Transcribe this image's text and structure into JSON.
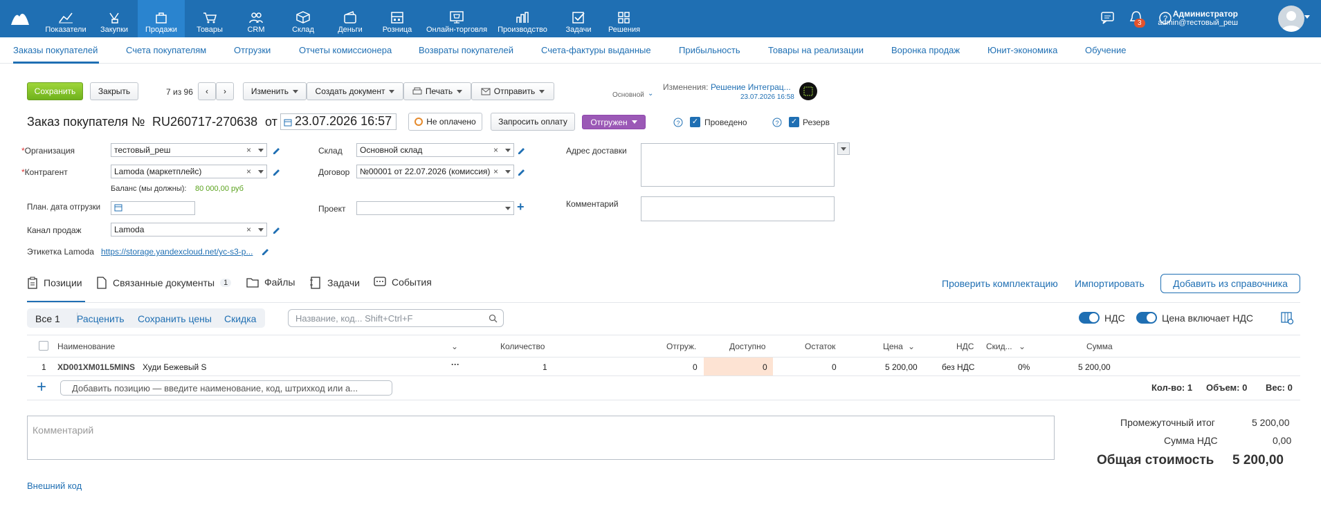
{
  "topnav": {
    "items": [
      {
        "label": "Показатели",
        "icon": "chart-icon"
      },
      {
        "label": "Закупки",
        "icon": "basket-hand-icon"
      },
      {
        "label": "Продажи",
        "icon": "bag-icon"
      },
      {
        "label": "Товары",
        "icon": "cart-icon"
      },
      {
        "label": "CRM",
        "icon": "people-icon"
      },
      {
        "label": "Склад",
        "icon": "box-icon"
      },
      {
        "label": "Деньги",
        "icon": "wallet-icon"
      },
      {
        "label": "Розница",
        "icon": "register-icon"
      },
      {
        "label": "Онлайн-торговля",
        "icon": "online-store-icon"
      },
      {
        "label": "Производство",
        "icon": "production-icon"
      },
      {
        "label": "Задачи",
        "icon": "tasks-icon"
      },
      {
        "label": "Решения",
        "icon": "apps-icon"
      }
    ],
    "notifications_count": "3",
    "user_name": "Администратор",
    "user_email": "admin@тестовый_реш"
  },
  "subnav": [
    "Заказы покупателей",
    "Счета покупателям",
    "Отгрузки",
    "Отчеты комиссионера",
    "Возвраты покупателей",
    "Счета-фактуры выданные",
    "Прибыльность",
    "Товары на реализации",
    "Воронка продаж",
    "Юнит-экономика",
    "Обучение"
  ],
  "toolbar": {
    "save": "Сохранить",
    "close": "Закрыть",
    "pager": "7 из 96",
    "change": "Изменить",
    "create_doc": "Создать документ",
    "print": "Печать",
    "send": "Отправить",
    "template": "Основной",
    "changes_label": "Изменения:",
    "changes_link": "Решение Интеграц...",
    "changes_date": "23.07.2026 16:58"
  },
  "doc": {
    "title": "Заказ покупателя №",
    "number": "RU260717-270638",
    "from": "от",
    "date": "23.07.2026 16:57",
    "payment": "Не оплачено",
    "request_payment": "Запросить оплату",
    "status": "Отгружен",
    "posted": "Проведено",
    "reserve": "Резерв"
  },
  "form": {
    "org_label": "Организация",
    "org": "тестовый_реш",
    "counterparty_label": "Контрагент",
    "counterparty": "Lamoda (маркетплейс)",
    "balance_label": "Баланс (мы должны):",
    "balance": "80 000,00 руб",
    "ship_date_label": "План. дата отгрузки",
    "channel_label": "Канал продаж",
    "channel": "Lamoda",
    "label_label": "Этикетка Lamoda",
    "label_link": "https://storage.yandexcloud.net/yc-s3-p...",
    "warehouse_label": "Склад",
    "warehouse": "Основной склад",
    "contract_label": "Договор",
    "contract": "№00001 от 22.07.2026 (комиссия)",
    "project_label": "Проект",
    "address_label": "Адрес доставки",
    "comment_label": "Комментарий"
  },
  "tabs": {
    "positions": "Позиции",
    "linked": "Связанные документы",
    "linked_count": "1",
    "files": "Файлы",
    "tasks": "Задачи",
    "events": "События",
    "check": "Проверить комплектацию",
    "import": "Импортировать",
    "add_from": "Добавить из справочника"
  },
  "filters": {
    "all": "Все 1",
    "price": "Расценить",
    "save_prices": "Сохранить цены",
    "discount": "Скидка",
    "search_placeholder": "Название, код... Shift+Ctrl+F",
    "vat": "НДС",
    "price_incl_vat": "Цена включает НДС"
  },
  "table": {
    "headers": [
      "Наименование",
      "Количество",
      "Отгруж.",
      "Доступно",
      "Остаток",
      "Цена",
      "НДС",
      "Скид...",
      "Сумма"
    ],
    "rows": [
      {
        "n": "1",
        "code": "XD001XM01L5MINS",
        "name": "Худи Бежевый S",
        "qty": "1",
        "shipped": "0",
        "available": "0",
        "rest": "0",
        "price": "5 200,00",
        "vat": "без НДС",
        "discount": "0%",
        "sum": "5 200,00"
      }
    ],
    "add_placeholder": "Добавить позицию — введите наименование, код, штрихкод или а...",
    "count": "Кол-во: 1",
    "volume": "Объем: 0",
    "weight": "Вес: 0"
  },
  "footer": {
    "comment_placeholder": "Комментарий",
    "subtotal_label": "Промежуточный итог",
    "subtotal": "5 200,00",
    "vat_label": "Сумма НДС",
    "vat": "0,00",
    "total_label": "Общая стоимость",
    "total": "5 200,00",
    "external_code": "Внешний код"
  }
}
